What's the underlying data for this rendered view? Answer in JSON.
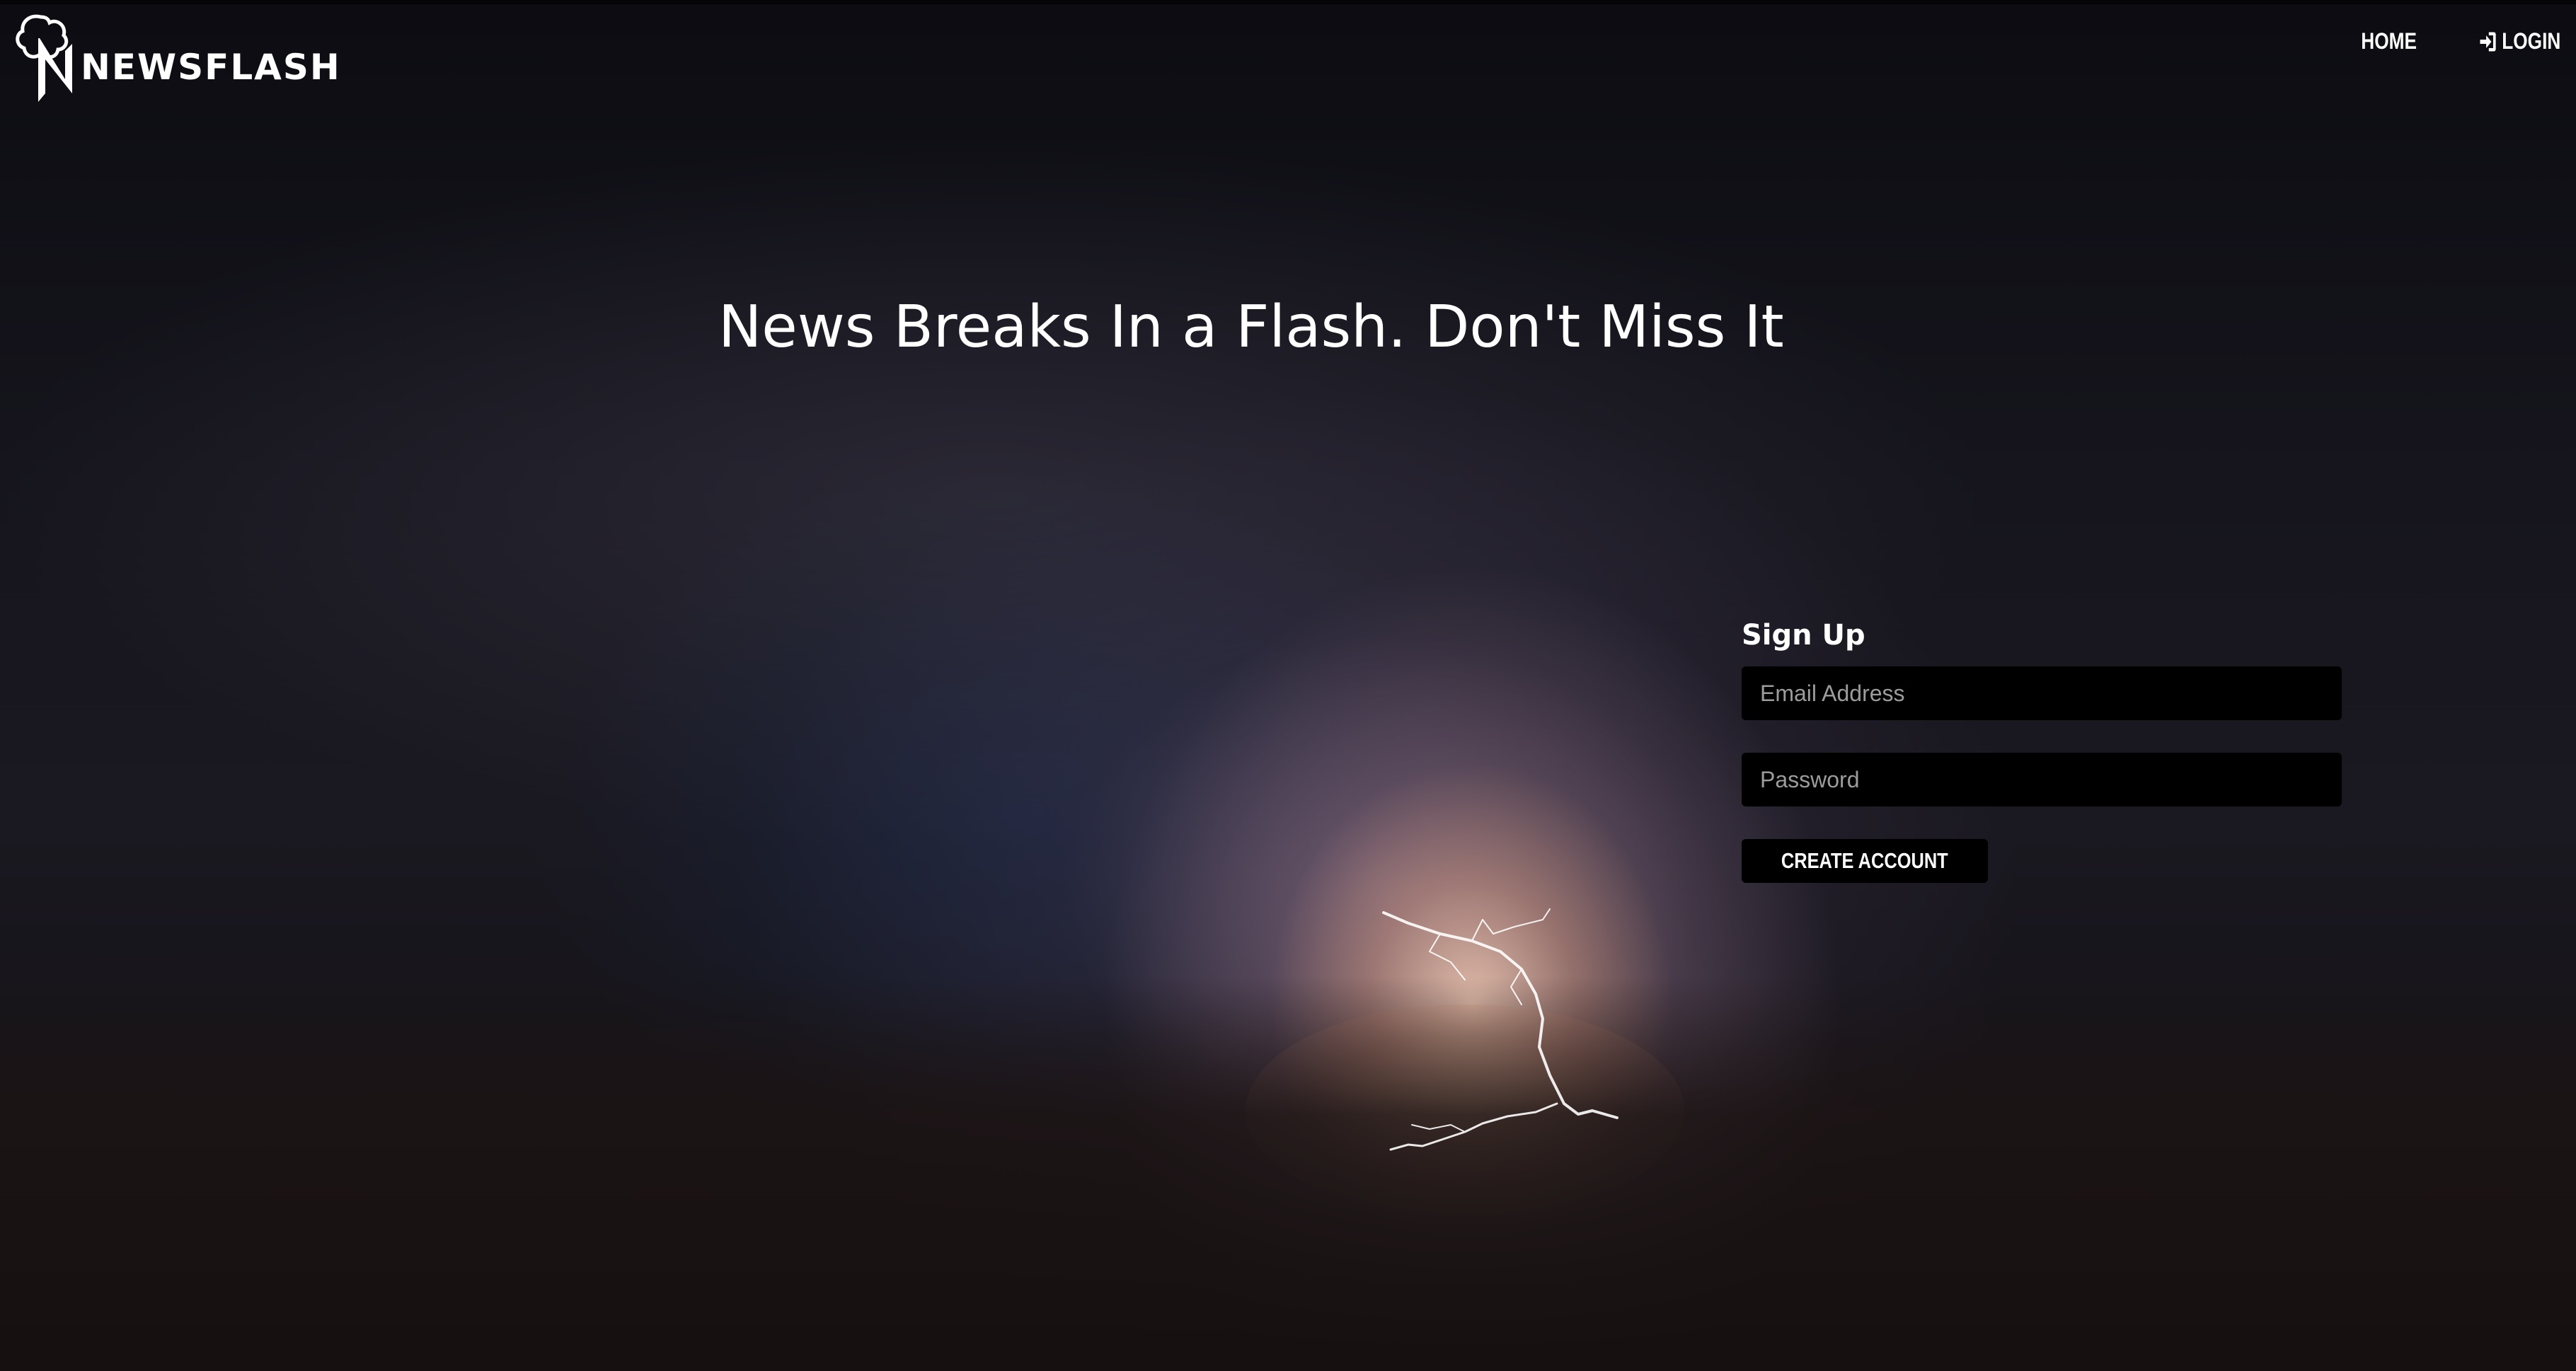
{
  "brand": {
    "logo_text": "NEWSFLASH",
    "logo_icon": "storm-face-n-icon"
  },
  "nav": {
    "home_label": "HOME",
    "login_label": "LOGIN",
    "login_icon": "sign-in-icon"
  },
  "hero": {
    "headline": "News Breaks In a Flash. Don't Miss It",
    "background": "night-sky-thunderstorm-lightning"
  },
  "signup": {
    "title": "Sign Up",
    "email_placeholder": "Email Address",
    "email_value": "",
    "password_placeholder": "Password",
    "password_value": "",
    "submit_label": "CREATE ACCOUNT"
  },
  "colors": {
    "input_bg": "#000000",
    "button_bg": "#000000",
    "text": "#ffffff",
    "placeholder": "#9c9c9c"
  }
}
